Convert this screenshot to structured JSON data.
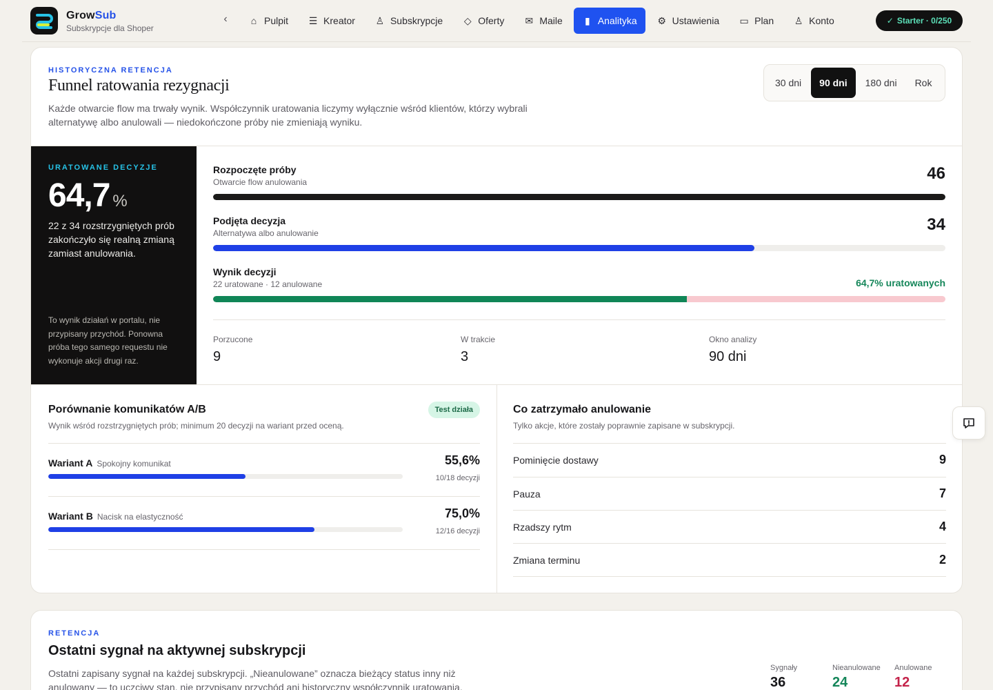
{
  "brand": {
    "name_part1": "Grow",
    "name_part2": "Sub",
    "subtitle": "Subskrypcje dla Shoper"
  },
  "nav": {
    "items": [
      {
        "label": "Pulpit",
        "icon": "home-icon"
      },
      {
        "label": "Kreator",
        "icon": "list-checks-icon"
      },
      {
        "label": "Subskrypcje",
        "icon": "users-icon"
      },
      {
        "label": "Oferty",
        "icon": "tag-icon"
      },
      {
        "label": "Maile",
        "icon": "mail-icon"
      },
      {
        "label": "Analityka",
        "icon": "bar-chart-icon",
        "active": true
      },
      {
        "label": "Ustawienia",
        "icon": "gear-icon"
      },
      {
        "label": "Plan",
        "icon": "credit-card-icon"
      },
      {
        "label": "Konto",
        "icon": "user-icon"
      }
    ],
    "plan_badge": "Starter · 0/250"
  },
  "funnel_card": {
    "eyebrow": "HISTORYCZNA RETENCJA",
    "title": "Funnel ratowania rezygnacji",
    "description": "Każde otwarcie flow ma trwały wynik. Współczynnik uratowania liczymy wyłącznie wśród klientów, którzy wybrali alternatywę albo anulowali — niedokończone próby nie zmieniają wyniku.",
    "ranges": [
      "30 dni",
      "90 dni",
      "180 dni",
      "Rok"
    ],
    "selected_range": "90 dni",
    "saved": {
      "eyebrow": "URATOWANE DECYZJE",
      "value": "64,7",
      "unit": "%",
      "description": "22 z 34 rozstrzygniętych prób zakończyło się realną zmianą zamiast anulowania.",
      "note": "To wynik działań w portalu, nie przypisany przychód. Ponowna próba tego samego requestu nie wykonuje akcji drugi raz."
    },
    "funnel": {
      "started": {
        "label": "Rozpoczęte próby",
        "sub": "Otwarcie flow anulowania",
        "value": "46",
        "fraction": 1.0
      },
      "decided": {
        "label": "Podjęta decyzja",
        "sub": "Alternatywa albo anulowanie",
        "value": "34",
        "fraction": 0.739
      },
      "result": {
        "label": "Wynik decyzji",
        "sub": "22 uratowane · 12 anulowane",
        "value": "64,7% uratowanych",
        "saved_fraction": 0.647
      }
    },
    "stats": [
      {
        "label": "Porzucone",
        "value": "9"
      },
      {
        "label": "W trakcie",
        "value": "3"
      },
      {
        "label": "Okno analizy",
        "value": "90 dni"
      }
    ],
    "ab": {
      "title": "Porównanie komunikatów A/B",
      "badge": "Test działa",
      "description": "Wynik wśród rozstrzygniętych prób; minimum 20 decyzji na wariant przed oceną.",
      "variants": [
        {
          "name": "Wariant A",
          "desc": "Spokojny komunikat",
          "pct": "55,6%",
          "decisions": "10/18 decyzji",
          "fraction": 0.556
        },
        {
          "name": "Wariant B",
          "desc": "Nacisk na elastyczność",
          "pct": "75,0%",
          "decisions": "12/16 decyzji",
          "fraction": 0.75
        }
      ]
    },
    "stoppers": {
      "title": "Co zatrzymało anulowanie",
      "description": "Tylko akcje, które zostały poprawnie zapisane w subskrypcji.",
      "rows": [
        {
          "label": "Pominięcie dostawy",
          "value": "9"
        },
        {
          "label": "Pauza",
          "value": "7"
        },
        {
          "label": "Rzadszy rytm",
          "value": "4"
        },
        {
          "label": "Zmiana terminu",
          "value": "2"
        }
      ]
    }
  },
  "retention_card": {
    "eyebrow": "RETENCJA",
    "title": "Ostatni sygnał na aktywnej subskrypcji",
    "description": "Ostatni zapisany sygnał na każdej subskrypcji. „Nieanulowane” oznacza bieżący status inny niż anulowany — to uczciwy stan, nie przypisany przychód ani historyczny współczynnik uratowania.",
    "stats": [
      {
        "label": "Sygnały",
        "value": "36",
        "color": "#17171a"
      },
      {
        "label": "Nieanulowane",
        "value": "24",
        "color": "#15865a"
      },
      {
        "label": "Anulowane",
        "value": "12",
        "color": "#c4234a"
      }
    ]
  },
  "colors": {
    "accent": "#1f52f0",
    "saved_green": "#15865a",
    "cancel_pink": "#f8c9cf",
    "dark_panel": "#111010"
  }
}
